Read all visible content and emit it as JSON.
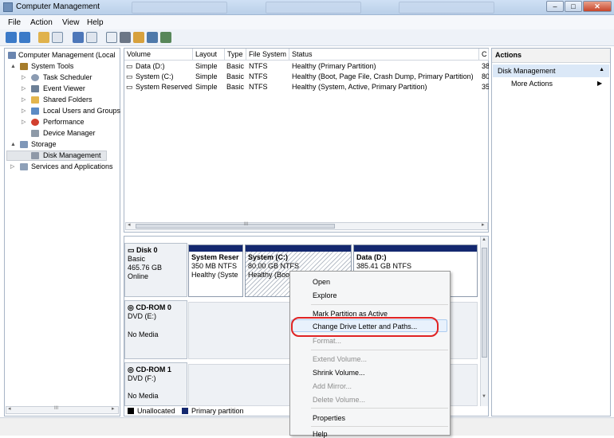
{
  "window": {
    "title": "Computer Management"
  },
  "menubar": [
    "File",
    "Action",
    "View",
    "Help"
  ],
  "tree": [
    {
      "label": "Computer Management (Local",
      "level": 0,
      "expander": "",
      "icon_color": "#6b86b0"
    },
    {
      "label": "System Tools",
      "level": 1,
      "expander": "▲",
      "icon_color": "#a67c2b"
    },
    {
      "label": "Task Scheduler",
      "level": 2,
      "expander": "▷",
      "icon_color": "#8b9bb2"
    },
    {
      "label": "Event Viewer",
      "level": 2,
      "expander": "▷",
      "icon_color": "#6c7f96"
    },
    {
      "label": "Shared Folders",
      "level": 2,
      "expander": "▷",
      "icon_color": "#e3b54d"
    },
    {
      "label": "Local Users and Groups",
      "level": 2,
      "expander": "▷",
      "icon_color": "#5b8bc5"
    },
    {
      "label": "Performance",
      "level": 2,
      "expander": "▷",
      "icon_color": "#d2402f"
    },
    {
      "label": "Device Manager",
      "level": 2,
      "expander": "",
      "icon_color": "#8e9aa8"
    },
    {
      "label": "Storage",
      "level": 1,
      "expander": "▲",
      "icon_color": "#7f97b8"
    },
    {
      "label": "Disk Management",
      "level": 2,
      "expander": "",
      "icon_color": "#8f99a8"
    },
    {
      "label": "Services and Applications",
      "level": 1,
      "expander": "▷",
      "icon_color": "#8ea0b8"
    }
  ],
  "volume_columns": [
    "Volume",
    "Layout",
    "Type",
    "File System",
    "Status",
    "C"
  ],
  "volumes": [
    {
      "name": "Data (D:)",
      "layout": "Simple",
      "type": "Basic",
      "fs": "NTFS",
      "status": "Healthy (Primary Partition)",
      "cap": "38"
    },
    {
      "name": "System (C:)",
      "layout": "Simple",
      "type": "Basic",
      "fs": "NTFS",
      "status": "Healthy (Boot, Page File, Crash Dump, Primary Partition)",
      "cap": "80"
    },
    {
      "name": "System Reserved",
      "layout": "Simple",
      "type": "Basic",
      "fs": "NTFS",
      "status": "Healthy (System, Active, Primary Partition)",
      "cap": "35"
    }
  ],
  "disk0": {
    "name": "Disk 0",
    "type": "Basic",
    "size": "465.76 GB",
    "status": "Online",
    "partitions": [
      {
        "name": "System Reser",
        "size": "350 MB NTFS",
        "status": "Healthy (Syste"
      },
      {
        "name": "System  (C:)",
        "size": "80.00 GB NTFS",
        "status": "Healthy (Boo"
      },
      {
        "name": "Data  (D:)",
        "size": "385.41 GB NTFS",
        "status": ""
      }
    ]
  },
  "cdrom0": {
    "name": "CD-ROM 0",
    "type": "DVD (E:)",
    "media": "No Media"
  },
  "cdrom1": {
    "name": "CD-ROM 1",
    "type": "DVD (F:)",
    "media": "No Media"
  },
  "legend": [
    {
      "label": "Unallocated",
      "color": "#000000"
    },
    {
      "label": "Primary partition",
      "color": "#14286f"
    }
  ],
  "actions": {
    "title": "Actions",
    "section": "Disk Management",
    "more": "More Actions"
  },
  "context_menu": [
    {
      "label": "Open",
      "disabled": false
    },
    {
      "label": "Explore",
      "disabled": false
    },
    {
      "label": "Mark Partition as Active",
      "disabled": false
    },
    {
      "label": "Change Drive Letter and Paths...",
      "disabled": false
    },
    {
      "label": "Format...",
      "disabled": true
    },
    {
      "label": "Extend Volume...",
      "disabled": true
    },
    {
      "label": "Shrink Volume...",
      "disabled": false
    },
    {
      "label": "Add Mirror...",
      "disabled": true
    },
    {
      "label": "Delete Volume...",
      "disabled": true
    },
    {
      "label": "Properties",
      "disabled": false
    },
    {
      "label": "Help",
      "disabled": false
    }
  ]
}
